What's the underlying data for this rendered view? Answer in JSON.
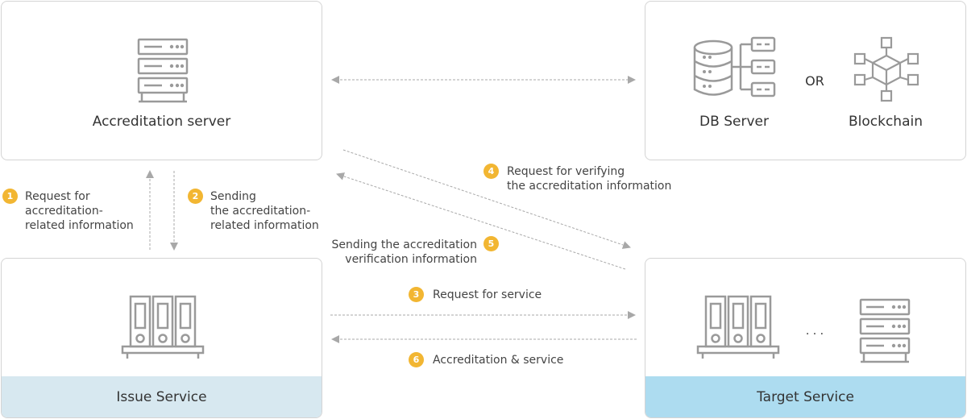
{
  "nodes": {
    "accreditation_server": {
      "label": "Accreditation server"
    },
    "db_server": {
      "label": "DB Server"
    },
    "or_text": "OR",
    "blockchain": {
      "label": "Blockchain"
    },
    "issue_service": {
      "label": "Issue Service",
      "header_color": "#d7e8f0"
    },
    "target_service": {
      "label": "Target Service",
      "header_color": "#addcf0",
      "ellipsis": "· · ·"
    }
  },
  "steps": [
    {
      "num": "1",
      "lines": [
        "Request for",
        "accreditation-",
        "related information"
      ]
    },
    {
      "num": "2",
      "lines": [
        "Sending",
        "the accreditation-",
        "related information"
      ]
    },
    {
      "num": "3",
      "lines": [
        "Request for service"
      ]
    },
    {
      "num": "4",
      "lines": [
        "Request for verifying",
        "the accreditation information"
      ]
    },
    {
      "num": "5",
      "lines": [
        "Sending the accreditation",
        "verification information"
      ]
    },
    {
      "num": "6",
      "lines": [
        "Accreditation & service"
      ]
    }
  ],
  "colors": {
    "icon": "#9a9a9a",
    "arrow": "#a8a8a8",
    "badge": "#f2b632"
  },
  "icons": [
    "server-rack-icon",
    "database-icon",
    "blockchain-icon",
    "binder-shelf-icon"
  ]
}
